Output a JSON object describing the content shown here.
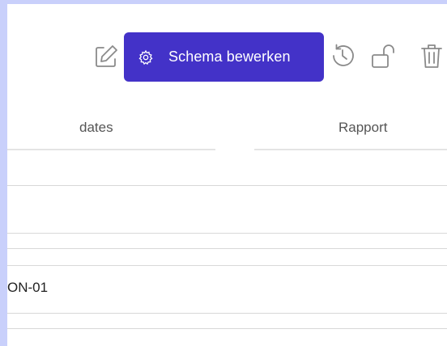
{
  "toolbar": {
    "edit_icon": "edit-icon",
    "schema_button_label": "Schema bewerken",
    "schema_button_icon": "gear-icon",
    "history_icon": "history-icon",
    "lock_icon": "unlock-icon",
    "trash_icon": "trash-icon",
    "accent_color": "#4332c8"
  },
  "table": {
    "columns": [
      "dates",
      "Rapport"
    ],
    "rows": [
      {
        "cell": ""
      },
      {
        "cell": ""
      },
      {
        "cell": ""
      },
      {
        "cell": "ON-01"
      },
      {
        "cell": ""
      }
    ]
  },
  "colors": {
    "frame_border": "#c9d0fb",
    "row_line": "#d8d8d8"
  }
}
